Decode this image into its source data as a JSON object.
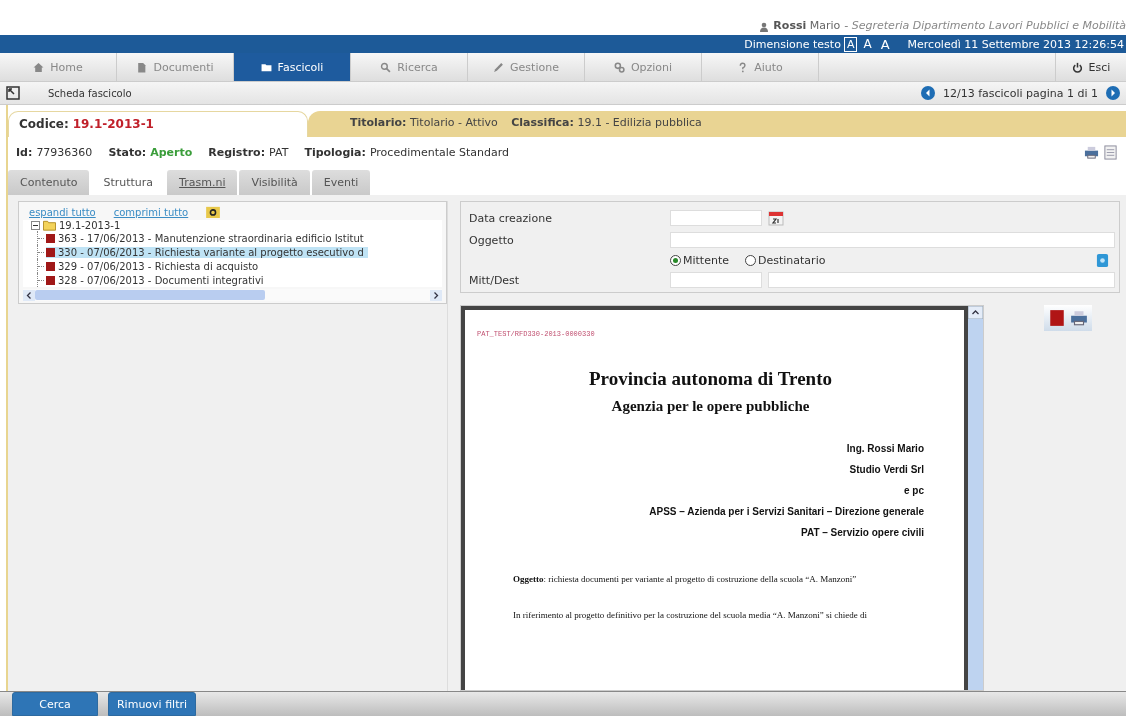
{
  "user": {
    "surname": "Rossi",
    "name": "Mario",
    "role": "- Segreteria Dipartimento Lavori Pubblici e Mobilità"
  },
  "topbar": {
    "text_size_label": "Dimensione testo",
    "text_sizes": [
      {
        "label": "A",
        "selected": true
      },
      {
        "label": "A",
        "selected": false
      },
      {
        "label": "A",
        "selected": false
      }
    ],
    "datetime": "Mercoledì 11 Settembre 2013 12:26:54"
  },
  "menu": {
    "items": [
      {
        "label": "Home",
        "selected": false
      },
      {
        "label": "Documenti",
        "selected": false
      },
      {
        "label": "Fascicoli",
        "selected": true
      },
      {
        "label": "Ricerca",
        "selected": false
      },
      {
        "label": "Gestione",
        "selected": false
      },
      {
        "label": "Opzioni",
        "selected": false
      },
      {
        "label": "Aiuto",
        "selected": false
      }
    ],
    "logout": "Esci"
  },
  "subheader": {
    "title": "Scheda fascicolo",
    "pager": "12/13 fascicoli pagina 1 di 1"
  },
  "fascicolo": {
    "codice_label": "Codice:",
    "codice": "19.1-2013-1",
    "titolario_label": "Titolario:",
    "titolario": "Titolario - Attivo",
    "classifica_label": "Classifica:",
    "classifica": "19.1 - Edilizia pubblica",
    "details": [
      {
        "label": "Id:",
        "value": "77936360",
        "kind": "plain"
      },
      {
        "label": "Stato:",
        "value": "Aperto",
        "kind": "status"
      },
      {
        "label": "Registro:",
        "value": "PAT",
        "kind": "plain"
      },
      {
        "label": "Tipologia:",
        "value": "Procedimentale Standard",
        "kind": "plain"
      }
    ]
  },
  "tabs": [
    {
      "label": "Contenuto",
      "selected": false,
      "kind": "plain"
    },
    {
      "label": "Struttura",
      "selected": true,
      "kind": "plain"
    },
    {
      "label": "Trasm.ni",
      "selected": false,
      "kind": "link"
    },
    {
      "label": "Visibilità",
      "selected": false,
      "kind": "plain"
    },
    {
      "label": "Eventi",
      "selected": false,
      "kind": "plain"
    }
  ],
  "tree": {
    "links": [
      "espandi tutto",
      "comprimi tutto"
    ],
    "root": {
      "label": "19.1-2013-1",
      "expanded": true,
      "children": [
        {
          "label": "363 - 17/06/2013 - Manutenzione straordinaria edificio Istitut",
          "selected": false
        },
        {
          "label": "330 - 07/06/2013 - Richiesta variante al progetto esecutivo d",
          "selected": true
        },
        {
          "label": "329 - 07/06/2013 - Richiesta di acquisto",
          "selected": false
        },
        {
          "label": "328 - 07/06/2013 - Documenti integrativi",
          "selected": false
        }
      ]
    }
  },
  "filters": {
    "data_creazione": "Data creazione",
    "oggetto": "Oggetto",
    "mitt_dest": "Mitt/Dest",
    "radios": [
      {
        "label": "Mittente",
        "selected": true
      },
      {
        "label": "Destinatario",
        "selected": false
      }
    ]
  },
  "document": {
    "protocol": "PAT_TEST/RFD330-2013-0000330",
    "title": "Provincia autonoma di Trento",
    "subtitle": "Agenzia per le opere pubbliche",
    "recipients": [
      "Ing. Rossi Mario",
      "Studio Verdi Srl",
      "e pc",
      "APSS – Azienda per i Servizi Sanitari – Direzione generale",
      "PAT – Servizio opere civili"
    ],
    "subject": "**Oggetto**: richiesta documenti per variante al progetto di costruzione della scuola “A. Manzoni”",
    "body": "In riferimento al progetto definitivo per la costruzione del scuola media “A. Manzoni” si chiede di"
  },
  "buttons": [
    "Cerca",
    "Rimuovi filtri"
  ]
}
